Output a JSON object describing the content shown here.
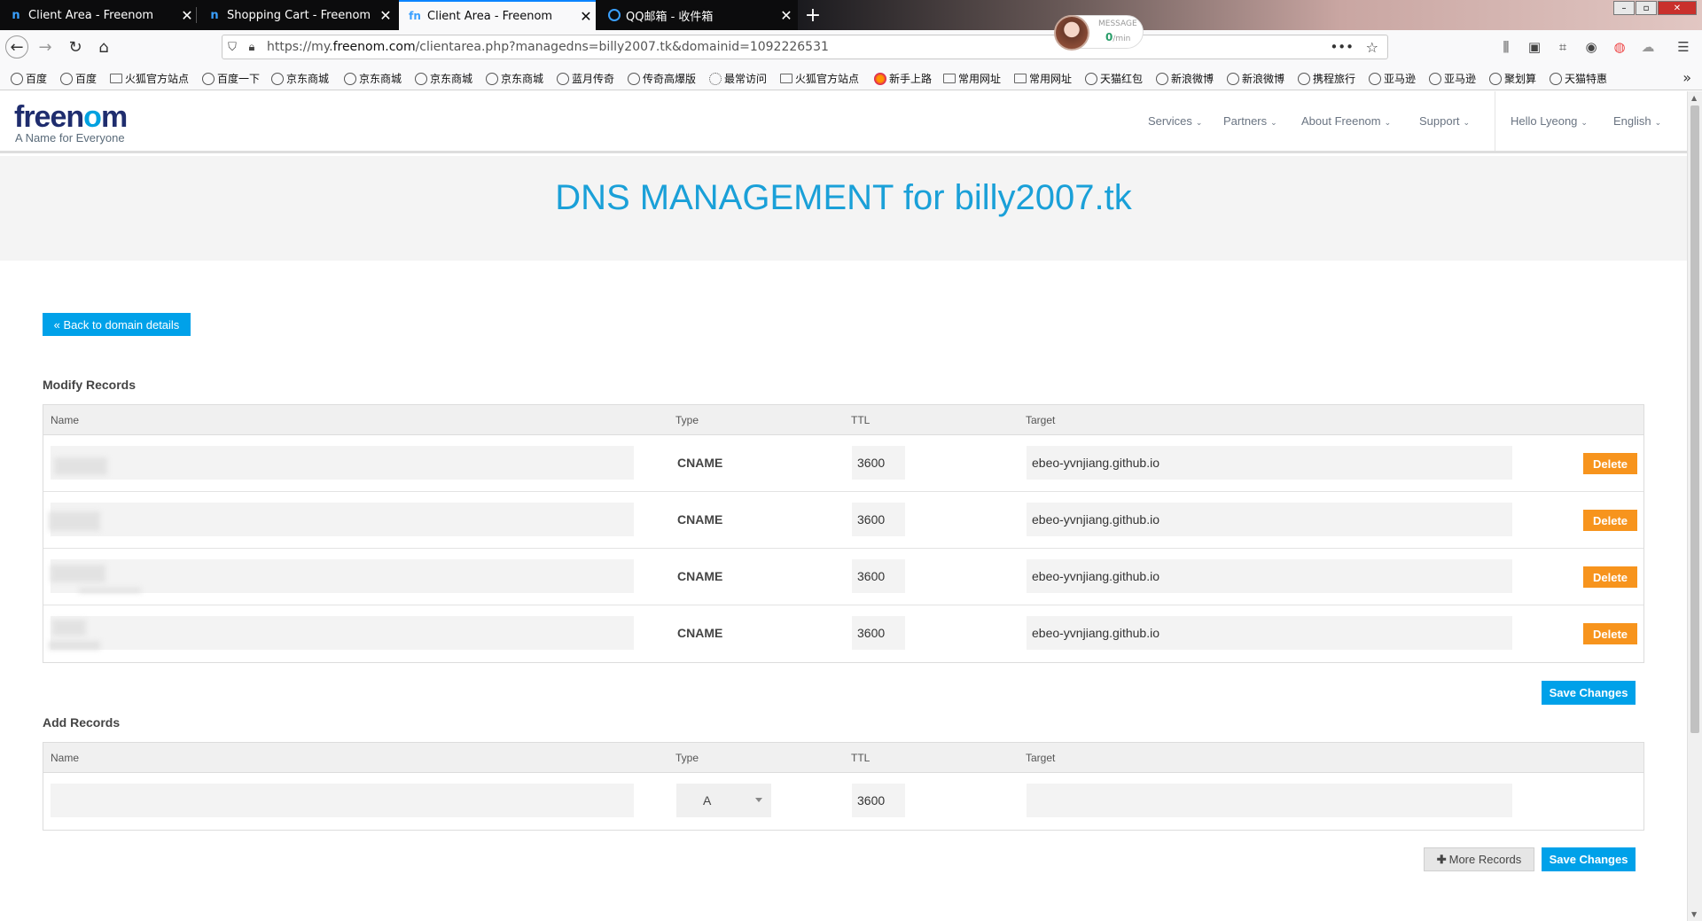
{
  "browser": {
    "tabs": [
      {
        "label": "Client Area - Freenom",
        "favicon": "n",
        "active": false
      },
      {
        "label": "Shopping Cart - Freenom",
        "favicon": "n",
        "active": false
      },
      {
        "label": "Client Area - Freenom",
        "favicon": "fn",
        "active": true
      },
      {
        "label": "QQ邮箱 - 收件箱",
        "favicon": "Q",
        "active": false
      }
    ],
    "url_prefix": "https://my.",
    "url_domain": "freenom.com",
    "url_path": "/clientarea.php?managedns=billy2007.tk&domainid=1092226531",
    "message_widget": {
      "label": "MESSAGE",
      "rate": "0",
      "unit": "/min"
    },
    "bookmarks": [
      {
        "label": "百度",
        "icon": "globe"
      },
      {
        "label": "百度",
        "icon": "globe"
      },
      {
        "label": "火狐官方站点",
        "icon": "folder"
      },
      {
        "label": "百度一下",
        "icon": "globe"
      },
      {
        "label": "京东商城",
        "icon": "globe"
      },
      {
        "label": "京东商城",
        "icon": "globe"
      },
      {
        "label": "京东商城",
        "icon": "globe"
      },
      {
        "label": "京东商城",
        "icon": "globe"
      },
      {
        "label": "蓝月传奇",
        "icon": "globe"
      },
      {
        "label": "传奇高爆版",
        "icon": "globe"
      },
      {
        "label": "最常访问",
        "icon": "gear"
      },
      {
        "label": "火狐官方站点",
        "icon": "folder"
      },
      {
        "label": "新手上路",
        "icon": "firefox"
      },
      {
        "label": "常用网址",
        "icon": "folder"
      },
      {
        "label": "常用网址",
        "icon": "folder"
      },
      {
        "label": "天猫红包",
        "icon": "globe"
      },
      {
        "label": "新浪微博",
        "icon": "globe"
      },
      {
        "label": "新浪微博",
        "icon": "globe"
      },
      {
        "label": "携程旅行",
        "icon": "globe"
      },
      {
        "label": "亚马逊",
        "icon": "globe"
      },
      {
        "label": "亚马逊",
        "icon": "globe"
      },
      {
        "label": "聚划算",
        "icon": "globe"
      },
      {
        "label": "天猫特惠",
        "icon": "globe"
      }
    ]
  },
  "site": {
    "logo_a": "free",
    "logo_b": "n",
    "logo_c": "o",
    "logo_d": "m",
    "tagline": "A Name for Everyone",
    "nav": [
      "Services",
      "Partners",
      "About Freenom",
      "Support",
      "Hello Lyeong",
      "English"
    ]
  },
  "hero": {
    "title": "DNS MANAGEMENT for billy2007.tk"
  },
  "back_button": "« Back to domain details",
  "modify": {
    "title": "Modify Records",
    "headers": {
      "name": "Name",
      "type": "Type",
      "ttl": "TTL",
      "target": "Target"
    },
    "records": [
      {
        "name": "",
        "type": "CNAME",
        "ttl": "3600",
        "target": "ebeo-yvnjiang.github.io",
        "delete": "Delete"
      },
      {
        "name": "",
        "type": "CNAME",
        "ttl": "3600",
        "target": "ebeo-yvnjiang.github.io",
        "delete": "Delete"
      },
      {
        "name": "",
        "type": "CNAME",
        "ttl": "3600",
        "target": "ebeo-yvnjiang.github.io",
        "delete": "Delete"
      },
      {
        "name": "",
        "type": "CNAME",
        "ttl": "3600",
        "target": "ebeo-yvnjiang.github.io",
        "delete": "Delete"
      }
    ],
    "save": "Save Changes"
  },
  "add": {
    "title": "Add Records",
    "headers": {
      "name": "Name",
      "type": "Type",
      "ttl": "TTL",
      "target": "Target"
    },
    "row": {
      "name": "",
      "type": "A",
      "ttl": "3600",
      "target": ""
    },
    "more": "More Records",
    "save": "Save Changes"
  },
  "colors": {
    "accent": "#00a1e9",
    "delete": "#f7941d",
    "title": "#1aa0d8",
    "logo_dark": "#1f2d6e"
  }
}
